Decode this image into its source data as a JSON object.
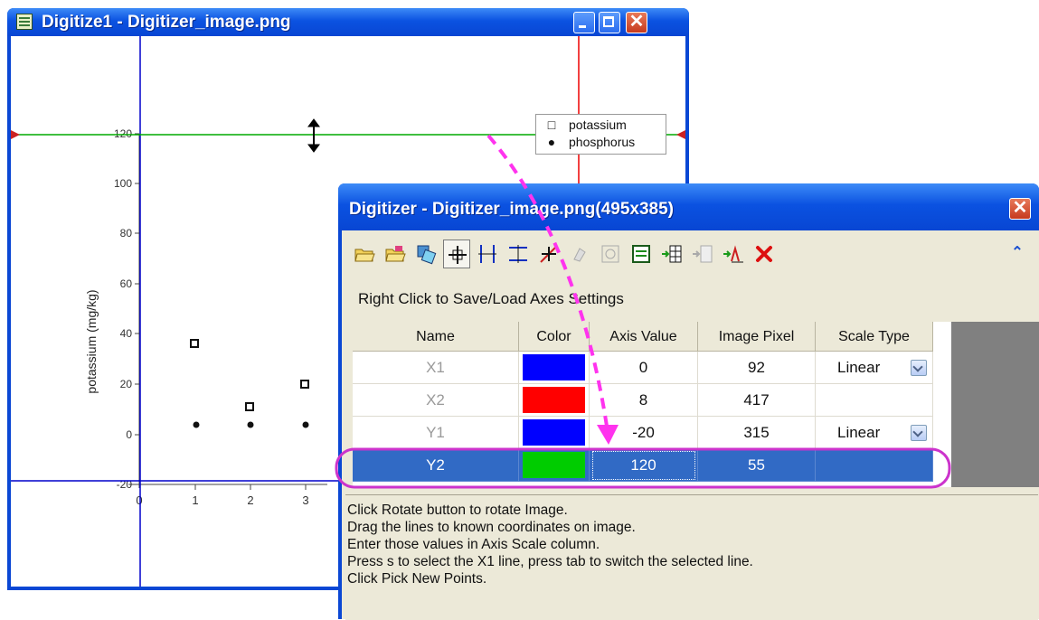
{
  "back_window": {
    "title": "Digitize1 - Digitizer_image.png",
    "plot": {
      "y_axis_label": "potassium (mg/kg)",
      "y_tick_labels": [
        "120",
        "100",
        "80",
        "60",
        "40",
        "20",
        "0",
        "-20"
      ],
      "x_tick_labels": [
        "0",
        "1",
        "2",
        "3"
      ],
      "legend": [
        {
          "marker": "□",
          "label": "potassium"
        },
        {
          "marker": "●",
          "label": "phosphorus"
        }
      ]
    },
    "colors": {
      "x_axis_lines": "#0000cc",
      "y2_line": "#00aa00",
      "red_line": "#ee0000"
    }
  },
  "digitizer": {
    "title": "Digitizer - Digitizer_image.png(495x385)",
    "hint": "Right Click to Save/Load Axes Settings",
    "toolbar": [
      {
        "name": "open-image-icon"
      },
      {
        "name": "open-folder-icon"
      },
      {
        "name": "rotate-image-icon"
      },
      {
        "name": "edit-axes-icon",
        "pressed": true
      },
      {
        "name": "x-axis-lines-icon"
      },
      {
        "name": "y-axis-lines-icon"
      },
      {
        "name": "pick-points-icon"
      },
      {
        "name": "erase-icon"
      },
      {
        "name": "zoom-icon"
      },
      {
        "name": "worksheet-icon"
      },
      {
        "name": "go-to-data-icon"
      },
      {
        "name": "data-disabled-icon"
      },
      {
        "name": "go-to-graph-icon"
      },
      {
        "name": "delete-icon"
      }
    ],
    "table": {
      "headers": [
        "Name",
        "Color",
        "Axis Value",
        "Image Pixel",
        "Scale Type"
      ],
      "rows": [
        {
          "name": "X1",
          "color": "#0000ff",
          "axis_value": "0",
          "image_pixel": "92",
          "scale_type": "Linear"
        },
        {
          "name": "X2",
          "color": "#ff0000",
          "axis_value": "8",
          "image_pixel": "417",
          "scale_type": ""
        },
        {
          "name": "Y1",
          "color": "#0000ff",
          "axis_value": "-20",
          "image_pixel": "315",
          "scale_type": "Linear"
        },
        {
          "name": "Y2",
          "color": "#00cc00",
          "axis_value": "120",
          "image_pixel": "55",
          "scale_type": "",
          "selected": true
        }
      ]
    },
    "status_lines": [
      "Click Rotate button to rotate Image.",
      "Drag the lines to known coordinates on image.",
      "Enter those values in Axis Scale column.",
      "Press s to select the X1 line, press tab to switch the selected line.",
      "Click Pick New Points."
    ]
  },
  "annotation": {
    "arrow_color": "#ff33ee",
    "highlight_color": "#cc33cc"
  }
}
